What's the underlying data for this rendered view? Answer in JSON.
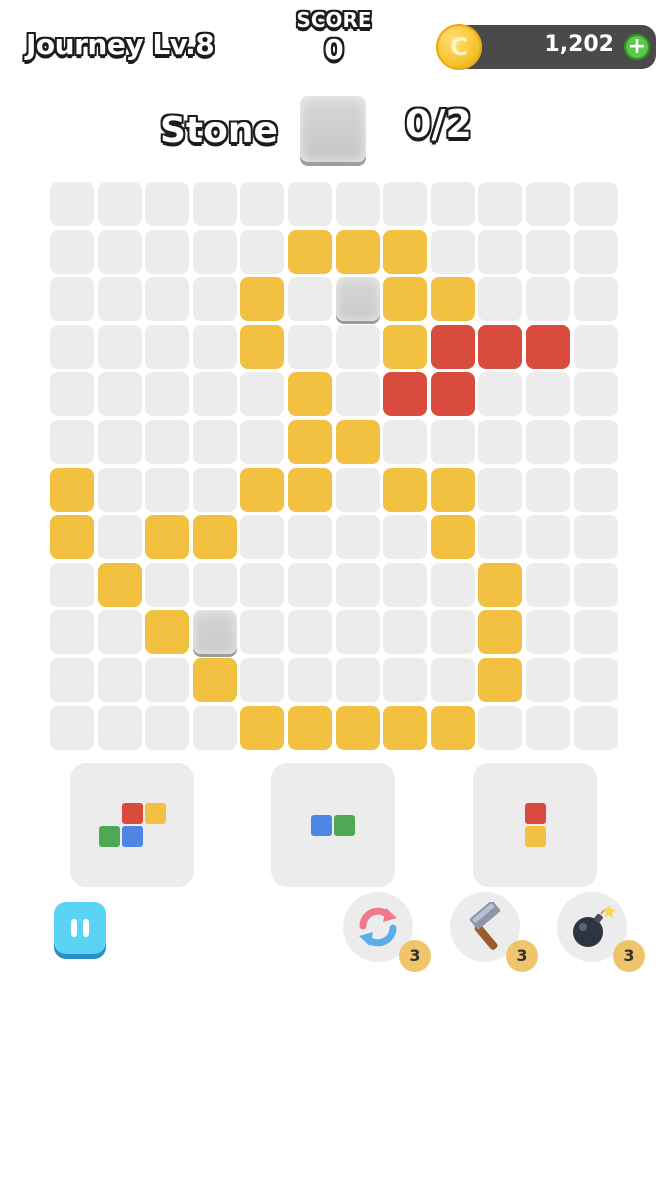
{
  "header": {
    "level_title": "Journey Lv.8",
    "score_label": "SCORE",
    "score_value": "0",
    "coins": "1,202",
    "coin_symbol": "C",
    "coin_add": "+"
  },
  "goal": {
    "label": "Stone",
    "progress": "0/2"
  },
  "board": {
    "rows": 12,
    "cols": 12,
    "legend": {
      "e": "empty",
      "y": "yellow",
      "r": "red",
      "s": "stone"
    },
    "grid": [
      "eeeeeeeeeeee",
      "eeeeeyyyeeee",
      "eeeeyesyyeee",
      "eeeeyeeyrrre",
      "eeeeeyerreee",
      "eeeeeyyeeeee",
      "yeeeyyeyyeee",
      "yeyyeeeeyeee",
      "eyeeeeeeeyee",
      "eeysEeeeeyee",
      "eeeyeeeeeyee",
      "eeeeyyyyyeee"
    ]
  },
  "pieces": [
    {
      "name": "piece-1",
      "blocks": [
        [
          "e",
          "r",
          "y"
        ],
        [
          "g",
          "b",
          "e"
        ]
      ]
    },
    {
      "name": "piece-2",
      "blocks": [
        [
          "b",
          "g"
        ]
      ]
    },
    {
      "name": "piece-3",
      "blocks": [
        [
          "r"
        ],
        [
          "y"
        ]
      ]
    }
  ],
  "boosters": [
    {
      "name": "shuffle",
      "icon": "shuffle-arrows-icon",
      "count": "3"
    },
    {
      "name": "hammer",
      "icon": "hammer-icon",
      "count": "3"
    },
    {
      "name": "bomb",
      "icon": "bomb-icon",
      "count": "3"
    }
  ],
  "colors": {
    "yellow": "#f2c141",
    "red": "#d94c3d",
    "green": "#4fa853",
    "blue": "#4f86e6",
    "empty": "#ececec"
  }
}
